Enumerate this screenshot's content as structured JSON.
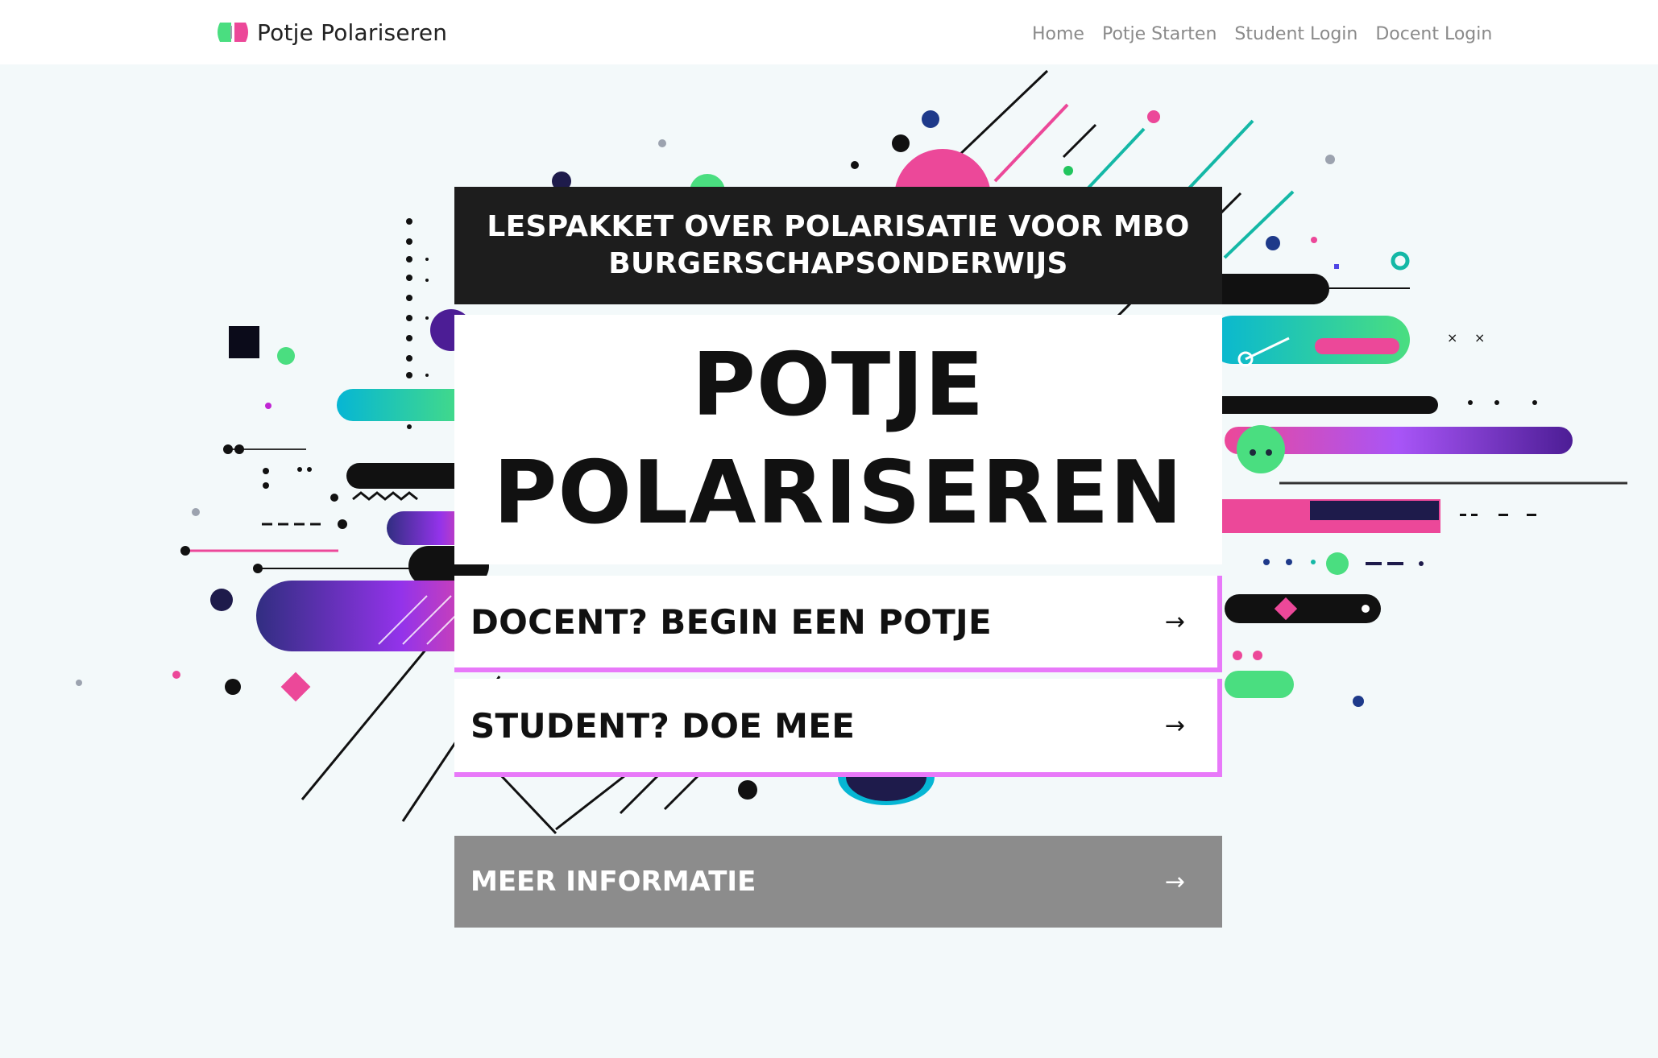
{
  "navbar": {
    "brand": "Potje Polariseren",
    "logo_icon": "pot-logo-icon",
    "links": [
      "Home",
      "Potje Starten",
      "Student Login",
      "Docent Login"
    ]
  },
  "hero": {
    "subtitle": "LESPAKKET OVER POLARISATIE VOOR MBO BURGERSCHAPSONDERWIJS",
    "title_line1": "POTJE",
    "title_line2": "POLARISEREN",
    "docent_button": "DOCENT? BEGIN EEN POTJE",
    "student_button": "STUDENT? DOE MEE",
    "info_button": "MEER INFORMATIE",
    "arrow": "→"
  },
  "colors": {
    "accent_pink": "#e879f9",
    "dark": "#1d1d1d",
    "info_gray": "#8c8c8c",
    "nav_link": "#8a8a8a"
  }
}
